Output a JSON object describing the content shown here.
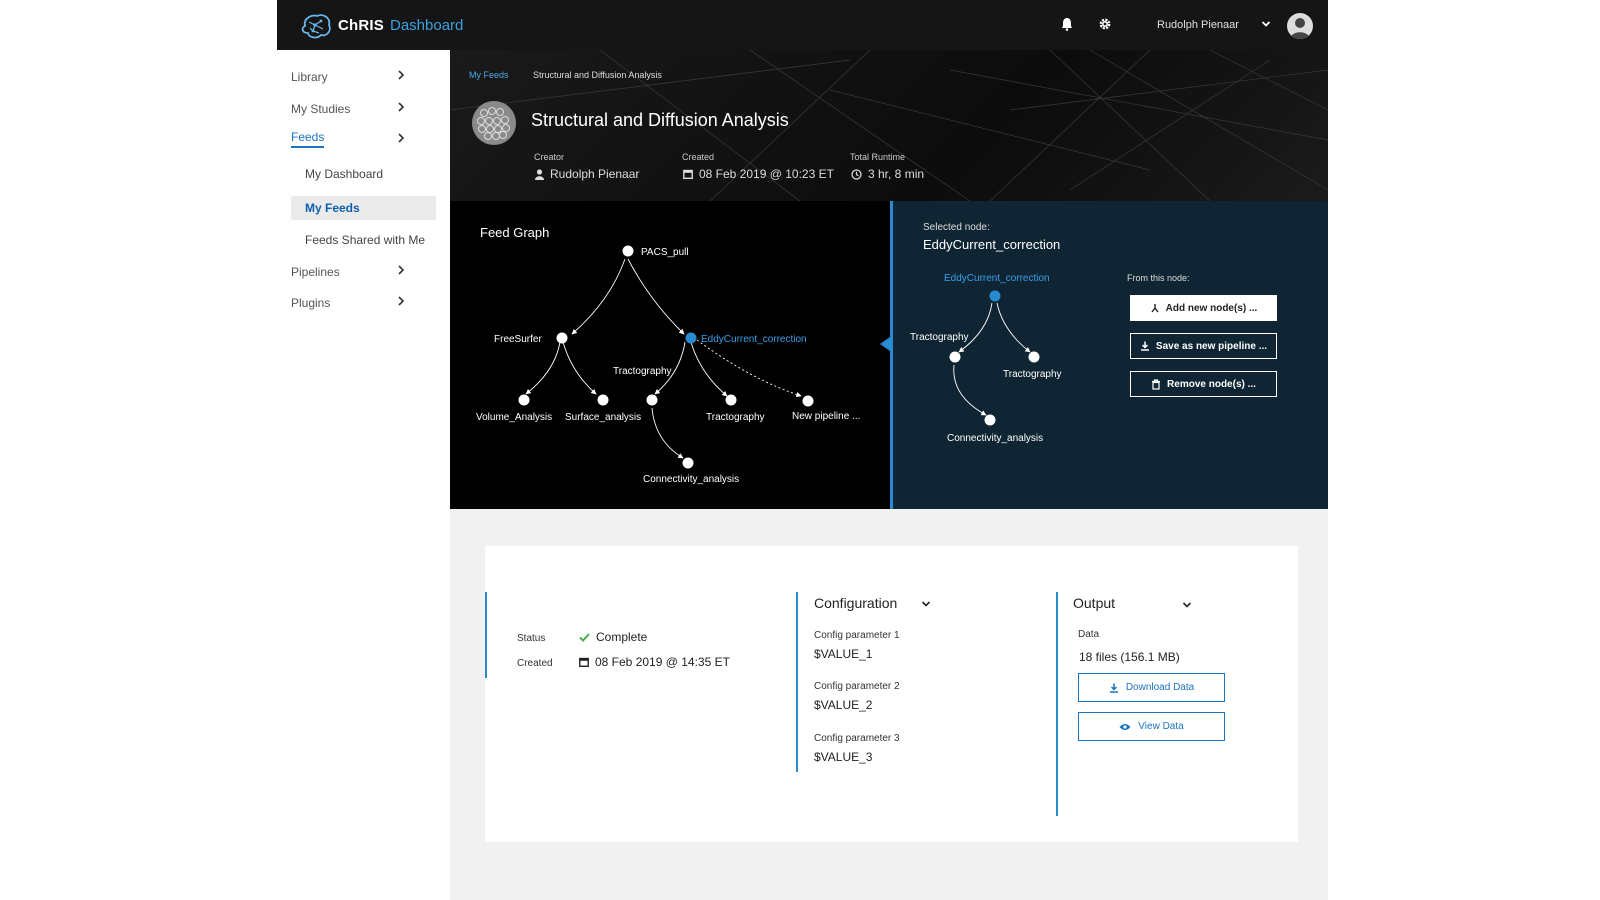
{
  "header": {
    "brand": "ChRIS",
    "brand_sub": "Dashboard",
    "user_name": "Rudolph Pienaar",
    "icons": [
      "brain-logo-icon",
      "bell-icon",
      "gear-icon",
      "chevron-down-icon",
      "user-avatar-icon"
    ]
  },
  "sidebar": {
    "items": [
      {
        "label": "Library"
      },
      {
        "label": "My Studies"
      },
      {
        "label": "Feeds"
      },
      {
        "label": "Pipelines"
      },
      {
        "label": "Plugins"
      }
    ],
    "feeds_sub": [
      {
        "label": "My Dashboard"
      },
      {
        "label": "My Feeds"
      },
      {
        "label": "Feeds Shared with Me"
      }
    ]
  },
  "breadcrumb": {
    "parent": "My Feeds",
    "current": "Structural and Diffusion Analysis"
  },
  "feed": {
    "title": "Structural and Diffusion Analysis",
    "creator_label": "Creator",
    "creator": "Rudolph Pienaar",
    "created_label": "Created",
    "created": "08 Feb 2019 @ 10:23 ET",
    "runtime_label": "Total Runtime",
    "runtime": "3 hr, 8 min"
  },
  "graph": {
    "title": "Feed Graph",
    "nodes": [
      "PACS_pull",
      "FreeSurfer",
      "EddyCurrent_correction",
      "Volume_Analysis",
      "Surface_analysis",
      "Tractography",
      "Tractography",
      "New pipeline ...",
      "Connectivity_analysis"
    ]
  },
  "panel": {
    "selected_label": "Selected node:",
    "selected_node": "EddyCurrent_correction",
    "subtree_nodes": [
      "EddyCurrent_correction",
      "Tractography",
      "Tractography",
      "Connectivity_analysis"
    ],
    "from_label": "From this node:",
    "buttons": [
      {
        "label": "Add new node(s) ..."
      },
      {
        "label": "Save as new pipeline ..."
      },
      {
        "label": "Remove node(s) ..."
      }
    ]
  },
  "details": {
    "status_label": "Status",
    "status": "Complete",
    "created_label": "Created",
    "created": "08 Feb 2019 @ 14:35 ET",
    "config_title": "Configuration",
    "config": [
      {
        "label": "Config parameter 1",
        "value": "$VALUE_1"
      },
      {
        "label": "Config parameter 2",
        "value": "$VALUE_2"
      },
      {
        "label": "Config parameter 3",
        "value": "$VALUE_3"
      }
    ],
    "output_title": "Output",
    "data_label": "Data",
    "data_value": "18 files (156.1 MB)",
    "download_label": "Download Data",
    "view_label": "View Data"
  },
  "colors": {
    "accent": "#2a8ad0",
    "link": "#1a73c0",
    "success": "#4caf50",
    "panel_bg": "#0f2534"
  }
}
